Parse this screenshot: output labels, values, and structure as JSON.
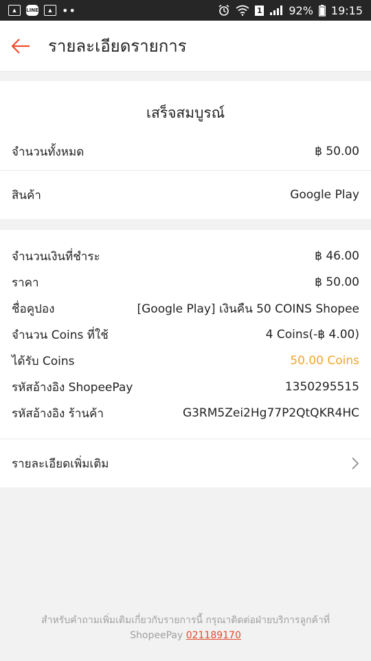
{
  "status_bar": {
    "battery": "92%",
    "time": "19:15",
    "sim": "1"
  },
  "header": {
    "title": "รายละเอียดรายการ"
  },
  "summary": {
    "status": "เสร็จสมบูรณ์",
    "total_label": "จำนวนทั้งหมด",
    "total_value": "฿ 50.00",
    "product_label": "สินค้า",
    "product_value": "Google Play"
  },
  "details": {
    "rows": [
      {
        "label": "จำนวนเงินที่ชำระ",
        "value": "฿ 46.00"
      },
      {
        "label": "ราคา",
        "value": "฿ 50.00"
      },
      {
        "label": "ชื่อคูปอง",
        "value": "[Google Play] เงินคืน 50 COINS Shopee"
      },
      {
        "label": "จำนวน Coins ที่ใช้",
        "value": "4 Coins(-฿ 4.00)"
      },
      {
        "label": "ได้รับ Coins",
        "value": "50.00 Coins"
      },
      {
        "label": "รหัสอ้างอิง ShopeePay",
        "value": "1350295515"
      },
      {
        "label": "รหัสอ้างอิง ร้านค้า",
        "value": "G3RM5Zei2Hg77P2QtQKR4HC"
      }
    ]
  },
  "more": {
    "label": "รายละเอียดเพิ่มเติม"
  },
  "footer": {
    "text": "สำหรับคำถามเพิ่มเติมเกี่ยวกับรายการนี้ กรุณาติดต่อฝ่ายบริการลูกค้าที่ ShopeePay",
    "phone": "021189170"
  },
  "colors": {
    "accent": "#ee4d2d",
    "coins": "#f0a531"
  },
  "icons": {
    "back": "arrow-left-icon",
    "chevron": "chevron-right-icon"
  }
}
